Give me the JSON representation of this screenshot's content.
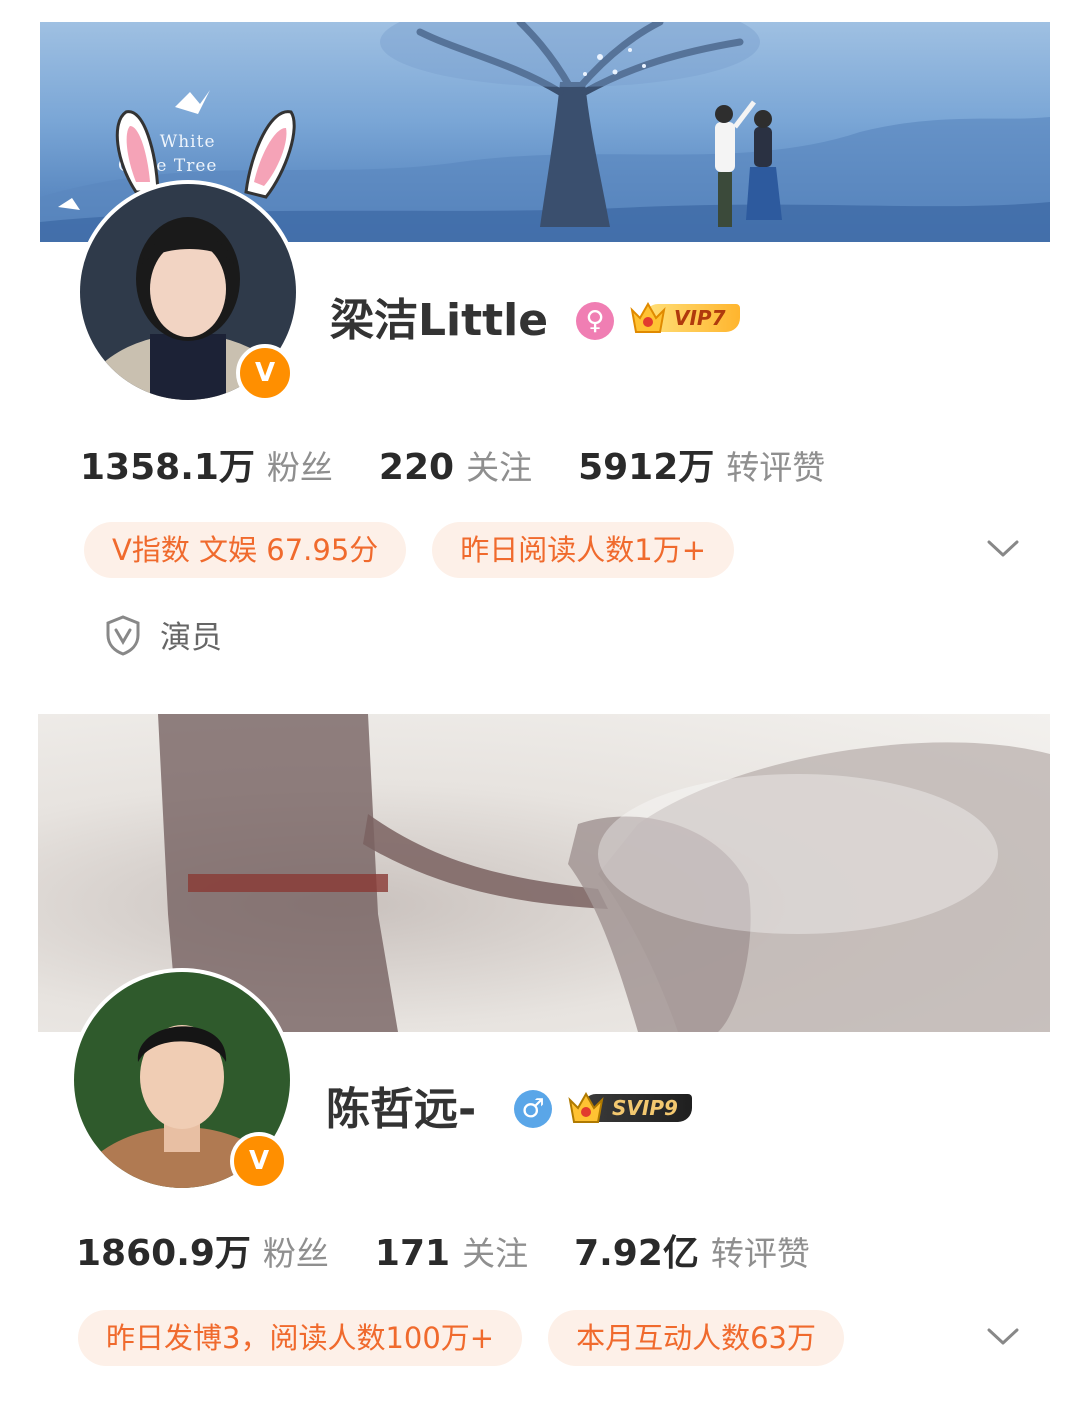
{
  "profiles": [
    {
      "banner_title": "The White Olive Tree",
      "name": "梁洁Little",
      "gender_icon": "female-icon",
      "vip_label": "VIP7",
      "verified_badge": "V",
      "stats": [
        {
          "value": "1358.1万",
          "label": "粉丝"
        },
        {
          "value": "220",
          "label": "关注"
        },
        {
          "value": "5912万",
          "label": "转评赞"
        }
      ],
      "tags": [
        "V指数 文娱 67.95分",
        "昨日阅读人数1万+"
      ],
      "verification": "演员"
    },
    {
      "name": "陈哲远-",
      "gender_icon": "male-icon",
      "vip_label": "SVIP9",
      "verified_badge": "V",
      "stats": [
        {
          "value": "1860.9万",
          "label": "粉丝"
        },
        {
          "value": "171",
          "label": "关注"
        },
        {
          "value": "7.92亿",
          "label": "转评赞"
        }
      ],
      "tags": [
        "昨日发博3，阅读人数100万+",
        "本月互动人数63万"
      ]
    }
  ],
  "colors": {
    "accent": "#f06a2d",
    "pill_bg": "#fdf0e8",
    "verified": "#ff8f00",
    "female": "#f07eb3",
    "male": "#5aa6e8"
  }
}
